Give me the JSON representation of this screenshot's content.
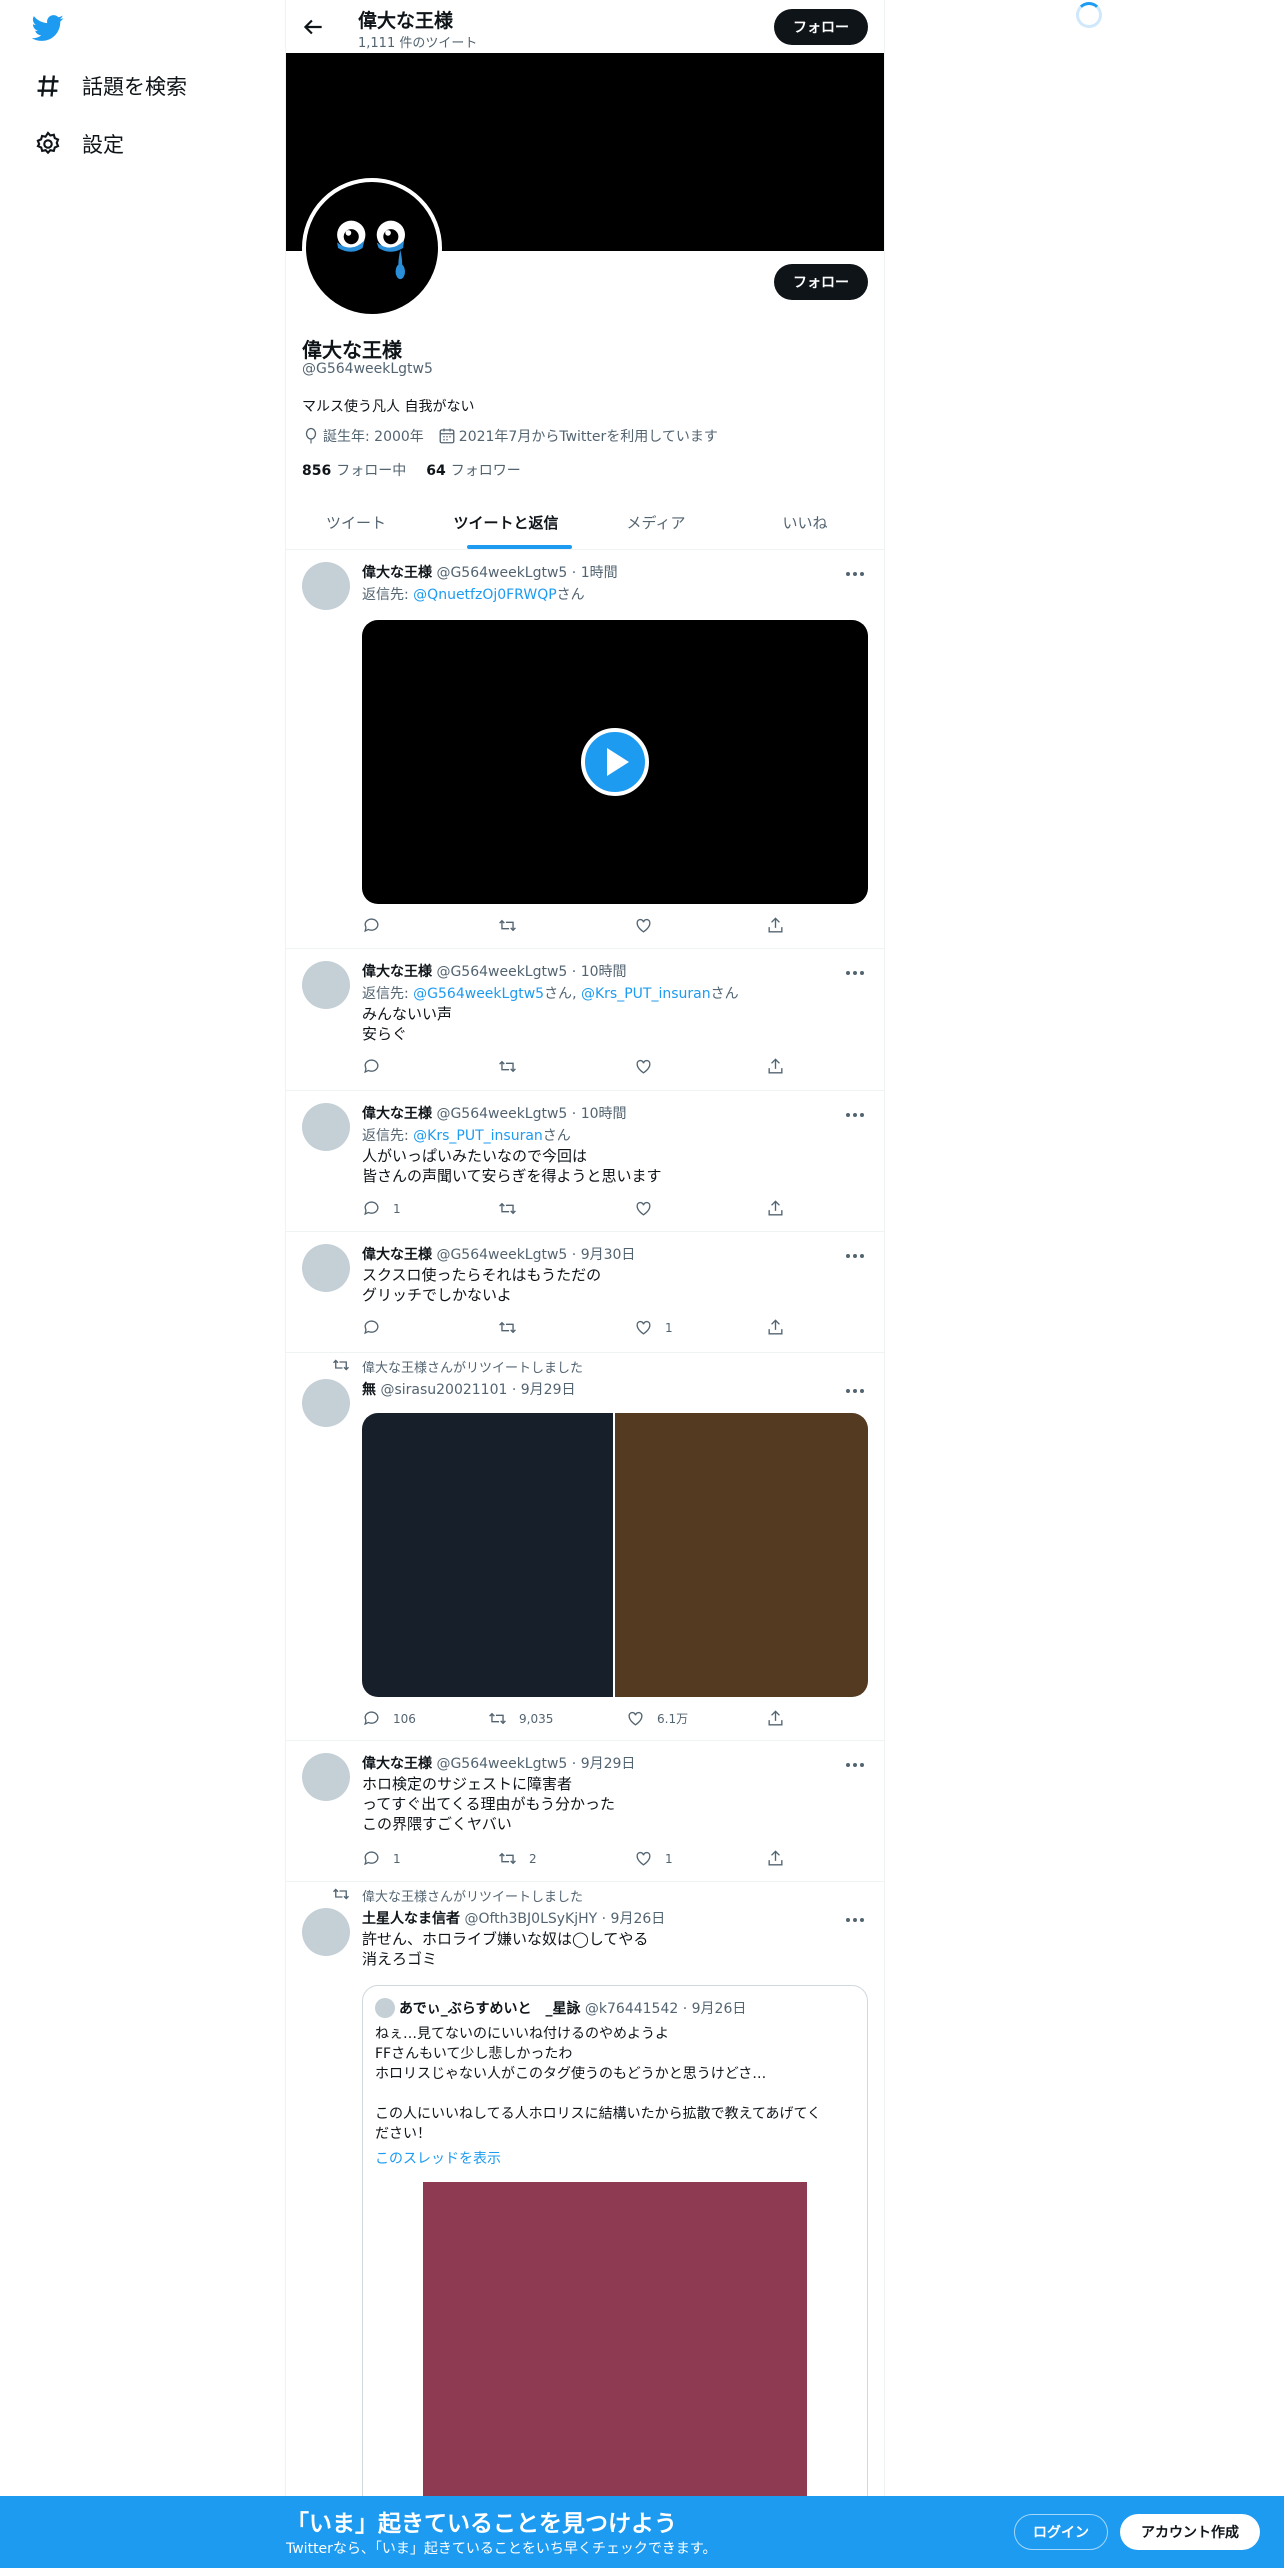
{
  "nav": {
    "explore_label": "話題を検索",
    "settings_label": "設定"
  },
  "header": {
    "name": "偉大な王様",
    "tweet_count": "1,111 件のツイート",
    "follow_label": "フォロー"
  },
  "profile": {
    "name": "偉大な王様",
    "handle": "@G564weekLgtw5",
    "bio": "マルス使う凡人 自我がない",
    "birth": "誕生年: 2000年",
    "joined": "2021年7月からTwitterを利用しています",
    "following_count": "856",
    "following_label": "フォロー中",
    "followers_count": "64",
    "followers_label": "フォロワー",
    "follow_label": "フォロー"
  },
  "tabs": [
    "ツイート",
    "ツイートと返信",
    "メディア",
    "いいね"
  ],
  "reply_prefix": "返信先:",
  "reply_suffix": "さん",
  "tweets": [
    {
      "name": "偉大な王様",
      "handle": "@G564weekLgtw5",
      "time": "· 1時間",
      "reply_to": "@QnuetfzOj0FRWQP"
    },
    {
      "name": "偉大な王様",
      "handle": "@G564weekLgtw5",
      "time": "· 10時間",
      "reply_to_1": "@G564weekLgtw5",
      "reply_to_2": "@Krs_PUT_insuran",
      "text": "みんないい声\n安らぐ"
    },
    {
      "name": "偉大な王様",
      "handle": "@G564weekLgtw5",
      "time": "· 10時間",
      "reply_to": "@Krs_PUT_insuran",
      "text": "人がいっぱいみたいなので今回は\n皆さんの声聞いて安らぎを得ようと思います",
      "replies": "1"
    },
    {
      "name": "偉大な王様",
      "handle": "@G564weekLgtw5",
      "time": "· 9月30日",
      "text": "スクスロ使ったらそれはもうただの\nグリッチでしかないよ",
      "likes": "1"
    },
    {
      "retweeted_by": "偉大な王様さんがリツイートしました",
      "name": "無",
      "handle": "@sirasu20021101",
      "time": "· 9月29日",
      "replies": "106",
      "retweets": "9,035",
      "likes": "6.1万"
    },
    {
      "name": "偉大な王様",
      "handle": "@G564weekLgtw5",
      "time": "· 9月29日",
      "text": "ホロ検定のサジェストに障害者\nってすぐ出てくる理由がもう分かった\nこの界隈すごくヤバい",
      "replies": "1",
      "retweets": "2",
      "likes": "1"
    },
    {
      "retweeted_by": "偉大な王様さんがリツイートしました",
      "name": "土星人なま信者",
      "handle": "@Ofth3BJ0LSyKjHY",
      "time": "· 9月26日",
      "text": "許せん、ホロライブ嫌いな奴は◯してやる\n消えろゴミ",
      "quote": {
        "name": "あでぃ_ぶらすめいと　_星詠",
        "handle": "@k76441542",
        "time": "· 9月26日",
        "text": "ねぇ…見てないのにいいね付けるのやめようよ\nFFさんもいて少し悲しかったわ\nホロリスじゃない人がこのタグ使うのもどうかと思うけどさ…\n\nこの人にいいねしてる人ホロリスに結構いたから拡散で教えてあげてく\nださい！",
        "thread_link": "このスレッドを表示"
      }
    }
  ],
  "bottom_bar": {
    "title": "「いま」起きていることを見つけよう",
    "subtitle": "Twitterなら、「いま」起きていることをいち早くチェックできます。",
    "login_label": "ログイン",
    "signup_label": "アカウント作成"
  },
  "colors": {
    "accent": "#1d9bf0",
    "text": "#0f1419",
    "muted": "#536471",
    "media_left": "#17202a",
    "media_right": "#553a22",
    "quote_image": "#8e3a52"
  }
}
